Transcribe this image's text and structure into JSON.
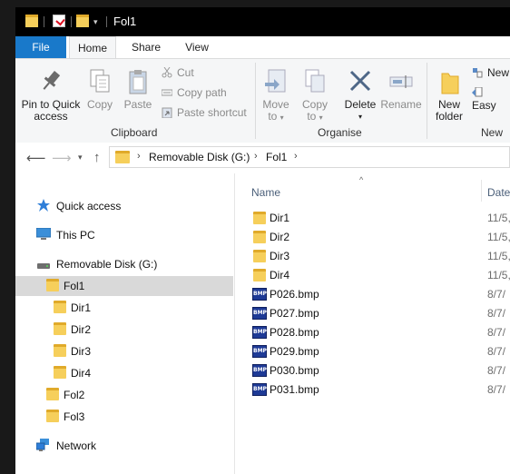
{
  "window": {
    "title": "Fol1"
  },
  "tabs": [
    "File",
    "Home",
    "Share",
    "View"
  ],
  "ribbon": {
    "clipboard": {
      "pin_line1": "Pin to Quick",
      "pin_line2": "access",
      "copy": "Copy",
      "paste": "Paste",
      "cut": "Cut",
      "copy_path": "Copy path",
      "paste_shortcut": "Paste shortcut",
      "group_label": "Clipboard"
    },
    "organise": {
      "move_to": "Move",
      "move_to2": "to",
      "copy_to": "Copy",
      "copy_to2": "to",
      "delete": "Delete",
      "rename": "Rename",
      "group_label": "Organise"
    },
    "new": {
      "new_folder1": "New",
      "new_folder2": "folder",
      "new_item": "New",
      "easy_access": "Easy",
      "group_label": "New"
    }
  },
  "address": {
    "crumbs": [
      "Removable Disk (G:)",
      "Fol1"
    ]
  },
  "nav": {
    "quick_access": "Quick access",
    "this_pc": "This PC",
    "removable_disk": "Removable Disk (G:)",
    "fol1": "Fol1",
    "dir1": "Dir1",
    "dir2": "Dir2",
    "dir3": "Dir3",
    "dir4": "Dir4",
    "fol2": "Fol2",
    "fol3": "Fol3",
    "network": "Network"
  },
  "columns": {
    "name": "Name",
    "date": "Date"
  },
  "files": [
    {
      "name": "Dir1",
      "date": "11/5,"
    },
    {
      "name": "Dir2",
      "date": "11/5,"
    },
    {
      "name": "Dir3",
      "date": "11/5,"
    },
    {
      "name": "Dir4",
      "date": "11/5,"
    },
    {
      "name": "P026.bmp",
      "date": "8/7/"
    },
    {
      "name": "P027.bmp",
      "date": "8/7/"
    },
    {
      "name": "P028.bmp",
      "date": "8/7/"
    },
    {
      "name": "P029.bmp",
      "date": "8/7/"
    },
    {
      "name": "P030.bmp",
      "date": "8/7/"
    },
    {
      "name": "P031.bmp",
      "date": "8/7/"
    }
  ],
  "bmp_icon_label": "BMP",
  "colors": {
    "file_tab": "#1979ca",
    "folder": "#f6cf5b",
    "selection": "#d9d9d9"
  }
}
